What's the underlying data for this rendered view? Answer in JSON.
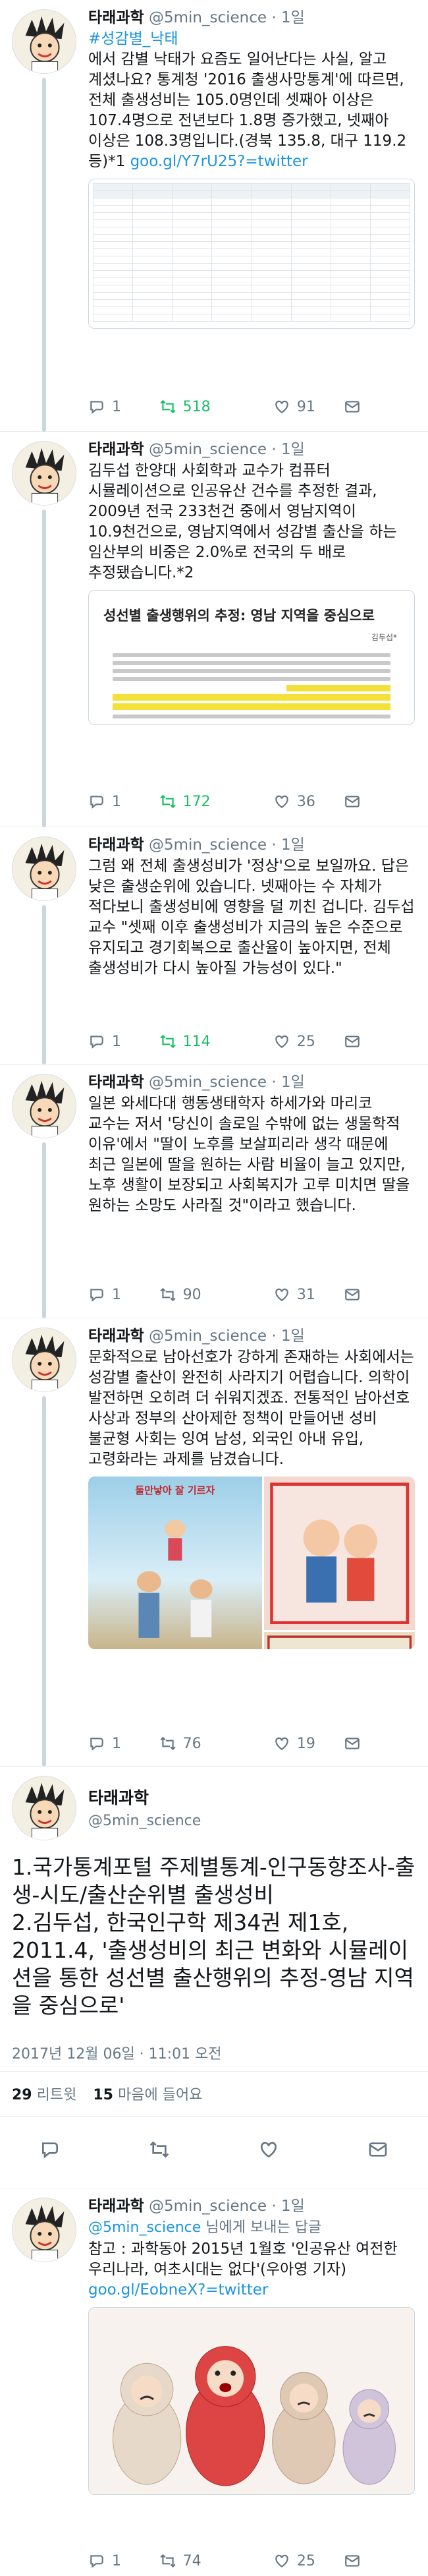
{
  "tweets": [
    {
      "name": "타래과학",
      "handle": "@5min_science",
      "time": "· 1일",
      "text_pre": "",
      "hashtag": "#성감별_낙태",
      "text": "에서 감별 낙태가 요즘도 일어난다는 사실, 알고 계셨나요? 통계청 '2016 출생사망통계'에 따르면, 전체 출생성비는 105.0명인데 셋째아 이상은 107.4명으로 전년보다 1.8명 증가했고, 넷째아 이상은 108.3명입니다.(경북 135.8, 대구 119.2 등)*1 ",
      "link": "goo.gl/Y7rU25?=twitter",
      "reply": "1",
      "retweet": "518",
      "like": "91"
    },
    {
      "name": "타래과학",
      "handle": "@5min_science",
      "time": "· 1일",
      "text": "김두섭 한양대 사회학과 교수가 컴퓨터 시뮬레이션으로 인공유산 건수를 추정한 결과, 2009년 전국 233천건 중에서 영남지역이 10.9천건으로, 영남지역에서 성감별 출산을 하는 임산부의 비중은 2.0%로 전국의 두 배로 추정됐습니다.*2",
      "doc_title": "성선별 출생행위의 추정: 영남 지역을 중심으로",
      "doc_author": "김두섭*",
      "reply": "1",
      "retweet": "172",
      "like": "36"
    },
    {
      "name": "타래과학",
      "handle": "@5min_science",
      "time": "· 1일",
      "text": "그럼 왜 전체 출생성비가 '정상'으로 보일까요. 답은 낮은 출생순위에 있습니다. 넷째아는 수 자체가 적다보니 출생성비에 영향을 덜 끼친 겁니다. 김두섭 교수 \"셋째 이후 출생성비가 지금의 높은 수준으로 유지되고 경기회복으로 출산율이 높아지면, 전체 출생성비가 다시 높아질 가능성이 있다.\"",
      "reply": "1",
      "retweet": "114",
      "like": "25"
    },
    {
      "name": "타래과학",
      "handle": "@5min_science",
      "time": "· 1일",
      "text": "일본 와세다대 행동생태학자 하세가와 마리코 교수는 저서 '당신이 솔로일 수밖에 없는 생물학적 이유'에서 \"딸이 노후를 보살피리라 생각 때문에 최근 일본에 딸을 원하는 사람 비율이 늘고 있지만, 노후 생활이 보장되고 사회복지가 고루 미치면 딸을 원하는 소망도 사라질 것\"이라고 했습니다.",
      "reply": "1",
      "retweet": "90",
      "like": "31"
    },
    {
      "name": "타래과학",
      "handle": "@5min_science",
      "time": "· 1일",
      "text": "문화적으로 남아선호가 강하게 존재하는 사회에서는 성감별 출산이 완전히 사라지기 어렵습니다. 의학이 발전하면 오히려 더 쉬워지겠죠. 전통적인 남아선호 사상과 정부의 산아제한 정책이 만들어낸 성비 불균형 사회는 잉여 남성, 외국인 아내 유입, 고령화라는 과제를 남겼습니다.",
      "poster_text": "둘만낳아 잘 기르자",
      "reply": "1",
      "retweet": "76",
      "like": "19"
    }
  ],
  "focused": {
    "name": "타래과학",
    "handle": "@5min_science",
    "text": "1.국가통계포털 주제별통계-인구동향조사-출생-시도/출산순위별 출생성비\n2.김두섭, 한국인구학 제34권 제1호, 2011.4, '출생성비의 최근 변화와 시뮬레이션을 통한 성선별 출산행위의 추정-영남 지역을 중심으로'",
    "datetime": "2017년 12월 06일 · 11:01 오전",
    "retweets_count": "29",
    "retweets_label": "리트윗",
    "likes_count": "15",
    "likes_label": "마음에 들어요"
  },
  "related": {
    "name": "타래과학",
    "handle": "@5min_science",
    "time": "· 1일",
    "suffix": "님에게 보내는 답글",
    "text": "참고 : 과학동아 2015년 1월호 '인공유산 여전한 우리나라, 여초시대는 없다'(우아영 기자) ",
    "link": "goo.gl/EobneX?=twitter",
    "reply": "1",
    "retweet": "74",
    "like": "25"
  },
  "colors": {
    "link": "#1b95e0",
    "retweet": "#17bf63",
    "muted": "#657786"
  }
}
